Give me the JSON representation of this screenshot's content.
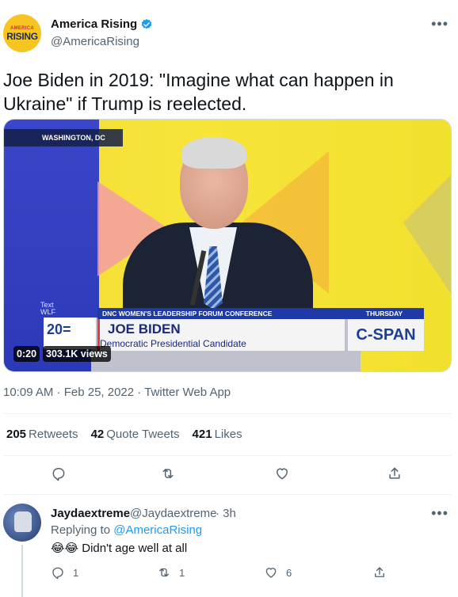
{
  "author": {
    "name": "America Rising",
    "handle": "@AmericaRising",
    "avatar_line1": "AMERICA",
    "avatar_line2": "RISING",
    "verified": true
  },
  "tweet": {
    "text": "Joe Biden in 2019: \"Imagine what can happen in Ukraine\" if Trump is reelected.",
    "timestamp": "10:09 AM · Feb 25, 2022",
    "source": "Twitter Web App",
    "more_icon": "more-horizontal-icon"
  },
  "video": {
    "dateline": "WASHINGTON, DC",
    "event": "DNC WOMEN'S LEADERSHIP FORUM CONFERENCE",
    "day": "THURSDAY",
    "speaker_name": "JOE BIDEN",
    "speaker_title": "Democratic Presidential Candidate",
    "network": "C-SPAN",
    "logo_text": "20=",
    "backdrop_text": "Text\nWLF",
    "duration": "0:20",
    "views": "303.1K views"
  },
  "stats": {
    "retweets_count": "205",
    "retweets_label": "Retweets",
    "quotes_count": "42",
    "quotes_label": "Quote Tweets",
    "likes_count": "421",
    "likes_label": "Likes"
  },
  "actions": [
    "reply-icon",
    "retweet-icon",
    "like-icon",
    "share-icon"
  ],
  "reply": {
    "name": "Jaydaextreme",
    "handle": "@Jaydaextreme",
    "time": "· 3h",
    "replying_prefix": "Replying to",
    "replying_to": "@AmericaRising",
    "emoji": "😂😂",
    "text": "Didn't age well at all",
    "reply_count": "1",
    "retweet_count": "1",
    "like_count": "6"
  },
  "colors": {
    "link": "#1d9bf0",
    "secondary_text": "#536471",
    "primary_text": "#0f1419"
  }
}
